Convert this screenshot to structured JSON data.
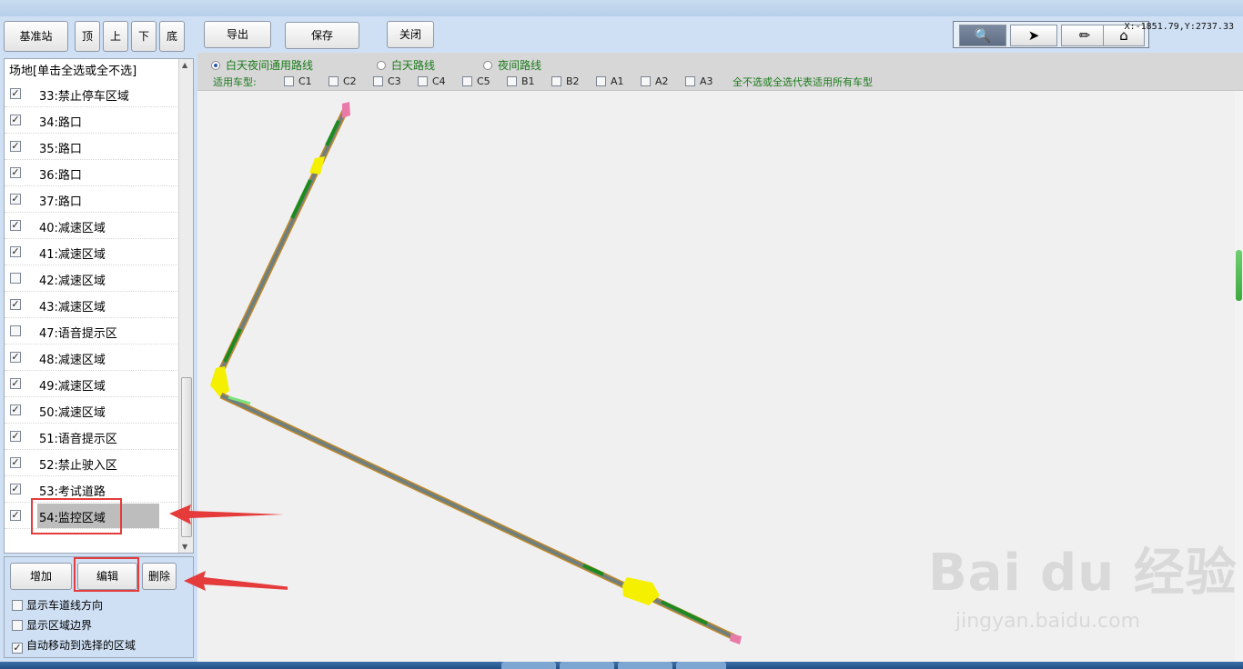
{
  "left_panel": {
    "buttons": {
      "base": "基准站",
      "top": "顶",
      "up": "上",
      "down": "下",
      "bottom": "底"
    },
    "list_header": "场地[单击全选或全不选]",
    "items": [
      {
        "label": "33:禁止停车区域",
        "checked": true
      },
      {
        "label": "34:路口",
        "checked": true
      },
      {
        "label": "35:路口",
        "checked": true
      },
      {
        "label": "36:路口",
        "checked": true
      },
      {
        "label": "37:路口",
        "checked": true
      },
      {
        "label": "40:减速区域",
        "checked": true
      },
      {
        "label": "41:减速区域",
        "checked": true
      },
      {
        "label": "42:减速区域",
        "checked": false
      },
      {
        "label": "43:减速区域",
        "checked": true
      },
      {
        "label": "47:语音提示区",
        "checked": false
      },
      {
        "label": "48:减速区域",
        "checked": true
      },
      {
        "label": "49:减速区域",
        "checked": true
      },
      {
        "label": "50:减速区域",
        "checked": true
      },
      {
        "label": "51:语音提示区",
        "checked": true
      },
      {
        "label": "52:禁止驶入区",
        "checked": true
      },
      {
        "label": "53:考试道路",
        "checked": true
      },
      {
        "label": "54:监控区域",
        "checked": true,
        "selected": true
      }
    ],
    "actions": {
      "add": "增加",
      "edit": "编辑",
      "delete": "删除"
    },
    "options": [
      {
        "label": "显示车道线方向",
        "checked": false
      },
      {
        "label": "显示区域边界",
        "checked": false
      },
      {
        "label": "自动移动到选择的区域",
        "checked": true
      }
    ]
  },
  "toolbar": {
    "export": "导出",
    "save": "保存",
    "close": "关闭",
    "coords": "X:-1851.79,Y:2737.33"
  },
  "tools": [
    {
      "icon": "zoom-icon",
      "active": true
    },
    {
      "icon": "pointer-icon",
      "active": false
    },
    {
      "icon": "pencil-icon",
      "active": false
    },
    {
      "icon": "home-edit-icon",
      "active": false
    }
  ],
  "route": {
    "options": [
      {
        "label": "白天夜间通用路线",
        "selected": true
      },
      {
        "label": "白天路线",
        "selected": false
      },
      {
        "label": "夜间路线",
        "selected": false
      }
    ],
    "vehicle_label": "适用车型:",
    "vehicles": [
      "C1",
      "C2",
      "C3",
      "C4",
      "C5",
      "B1",
      "B2",
      "A1",
      "A2",
      "A3"
    ],
    "hint": "全不选或全选代表适用所有车型"
  },
  "watermark": {
    "brand": "Bai du 经验",
    "url": "jingyan.baidu.com"
  }
}
